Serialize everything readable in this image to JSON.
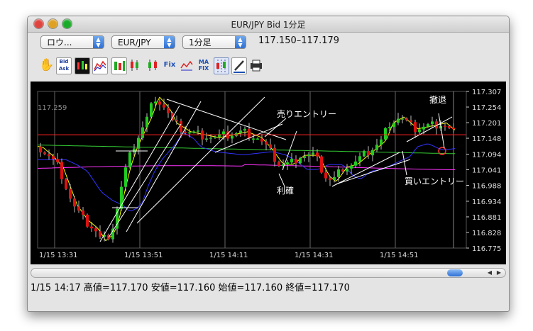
{
  "window": {
    "title": "EUR/JPY Bid 1分足",
    "traffic_lights": [
      "close",
      "minimize",
      "zoom"
    ],
    "colors": {
      "close": "#e0443e",
      "minimize": "#dea123",
      "zoom": "#1aab29"
    }
  },
  "toolbar": {
    "selectors": [
      {
        "name": "layout-select",
        "value": "ロウ..."
      },
      {
        "name": "pair-select",
        "value": "EUR/JPY"
      },
      {
        "name": "timeframe-select",
        "value": "1分足"
      }
    ],
    "range_text": "117.150–117.179",
    "tools": [
      "hand-icon",
      "bid-ask-icon",
      "candlestick-chart-icon",
      "line-chart-icon",
      "candles-icon-1",
      "candles-icon-2",
      "candles-icon-3",
      "fix-icon",
      "chart-options-icon",
      "ma-fix-icon",
      "grid-toggle-icon",
      "pen-icon",
      "print-icon"
    ]
  },
  "chart": {
    "label_price": "117.259",
    "y_ticks": [
      "117.307",
      "117.254",
      "117.201",
      "117.148",
      "117.094",
      "117.041",
      "116.988",
      "116.934",
      "116.881",
      "116.828",
      "116.775"
    ],
    "x_ticks": [
      "1/15 13:31",
      "1/15 13:51",
      "1/15 14:11",
      "1/15 14:31",
      "1/15 14:51"
    ],
    "annotations": [
      "売りエントリー",
      "利確",
      "撤退",
      "買いエントリー"
    ],
    "colors": {
      "background": "#000000",
      "bull": "#22cc22",
      "bear": "#dd1111",
      "ma_fast": "#ffff00",
      "ma_mid": "#3333ff",
      "ma_slow": "#ff33ff",
      "ma_long": "#33cc33",
      "price_line": "#ff2222"
    }
  },
  "chart_data": {
    "type": "line",
    "title": "",
    "xlabel": "",
    "ylabel": "",
    "x": [
      "1/15 13:31",
      "1/15 13:51",
      "1/15 14:11",
      "1/15 14:31",
      "1/15 14:51"
    ],
    "ylim": [
      116.775,
      117.307
    ],
    "current_price": 117.16,
    "label_price": 117.259,
    "series": [
      {
        "values": [
          117.12,
          116.82,
          117.29,
          117.15,
          117.04,
          117.2,
          117.17
        ]
      }
    ]
  },
  "status": {
    "text": "1/15 14:17  高値=117.170 安値=117.160 始値=117.160 終値=117.170"
  }
}
